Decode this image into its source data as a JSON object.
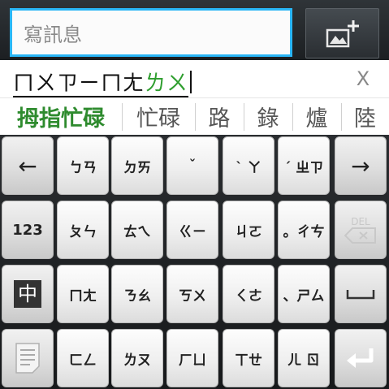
{
  "compose_bar": {
    "message_placeholder": "寫訊息",
    "attach_icon": "add-image-icon"
  },
  "composing": {
    "text_plain": "ㄇㄨㄗㄧㄇㄤ",
    "text_highlight": "ㄌㄨ",
    "close_label": "X"
  },
  "candidates": [
    "拇指忙碌",
    "忙碌",
    "路",
    "錄",
    "爐",
    "陸"
  ],
  "keyboard": {
    "row1": [
      "←",
      "ㄅㄢ",
      "ㄉㄞ",
      "ˇ",
      "ˋ ㄚ",
      "ˊ ㄓㄗ",
      "→"
    ],
    "row2": [
      "123",
      "ㄆㄣ",
      "ㄊㄟ",
      "ㄍㄧ",
      "ㄐㄛ",
      "。ㄔㄘ",
      "DEL"
    ],
    "row3": [
      "中",
      "ㄇㄤ",
      "ㄋㄠ",
      "ㄎㄨ",
      "ㄑㄜ",
      "、ㄕㄙ",
      "space"
    ],
    "row4": [
      "memo",
      "ㄈㄥ",
      "ㄌㄡ",
      "ㄏㄩ",
      "ㄒㄝ",
      "ㄦ ㄖ",
      "enter"
    ]
  },
  "colors": {
    "accent_focus": "#29b6f6",
    "candidate_highlight": "#2e8b2e",
    "keyboard_bg": "#202326"
  }
}
